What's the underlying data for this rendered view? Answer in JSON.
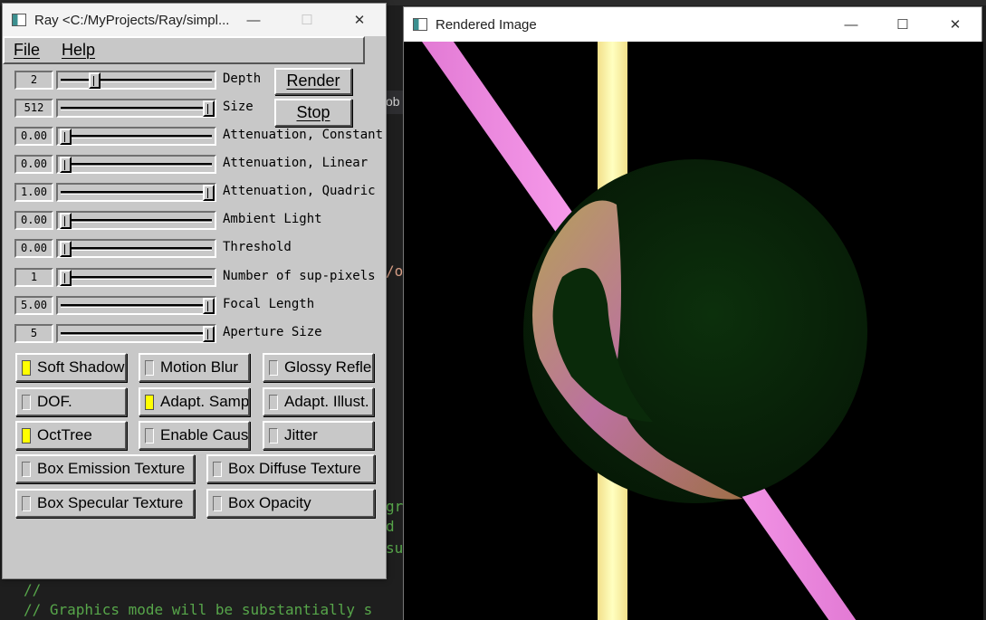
{
  "left_window": {
    "title": "Ray <C:/MyProjects/Ray/simpl...",
    "controls": {
      "minimize": "—",
      "maximize": "☐",
      "close": "✕"
    },
    "menu": [
      "File",
      "Help"
    ],
    "sliders": [
      {
        "value": "2",
        "label": "Depth",
        "position": 0.2
      },
      {
        "value": "512",
        "label": "Size",
        "position": 1.0
      },
      {
        "value": "0.00",
        "label": "Attenuation, Constant",
        "position": 0.0
      },
      {
        "value": "0.00",
        "label": "Attenuation, Linear",
        "position": 0.0
      },
      {
        "value": "1.00",
        "label": "Attenuation, Quadric",
        "position": 1.0
      },
      {
        "value": "0.00",
        "label": "Ambient Light",
        "position": 0.0
      },
      {
        "value": "0.00",
        "label": "Threshold",
        "position": 0.0
      },
      {
        "value": "1",
        "label": "Number of sup-pixels",
        "position": 0.0
      },
      {
        "value": "5.00",
        "label": "Focal Length",
        "position": 1.0
      },
      {
        "value": "5",
        "label": "Aperture Size",
        "position": 1.0
      }
    ],
    "buttons": {
      "render": "Render",
      "stop": "Stop"
    },
    "checkboxes": [
      {
        "label": "Soft Shadow",
        "checked": true
      },
      {
        "label": "Motion Blur",
        "checked": false
      },
      {
        "label": "Glossy Reflect.",
        "checked": false
      },
      {
        "label": "DOF.",
        "checked": false
      },
      {
        "label": "Adapt. Sampl.",
        "checked": true
      },
      {
        "label": "Adapt. Illust.",
        "checked": false
      },
      {
        "label": "OctTree",
        "checked": true
      },
      {
        "label": "Enable Caustic",
        "checked": false
      },
      {
        "label": "Jitter",
        "checked": false
      },
      {
        "label": "Box Emission Texture",
        "checked": false
      },
      {
        "label": "Box Diffuse Texture",
        "checked": false
      },
      {
        "label": "Box Specular Texture",
        "checked": false
      },
      {
        "label": "Box Opacity",
        "checked": false
      }
    ]
  },
  "right_window": {
    "title": "Rendered Image",
    "controls": {
      "minimize": "—",
      "maximize": "☐",
      "close": "✕"
    }
  },
  "background_code": {
    "line1": "//",
    "line2": "// Graphics mode will be substantially s",
    "frag1": "gr",
    "frag2": "d",
    "frag3": "su",
    "frag4": "/o",
    "frag5": "ob"
  },
  "colors": {
    "checked": "#ffff00",
    "dialog_bg": "#c8c8c8",
    "pink_beam": "#ff9cf0",
    "yellow_beam": "#ffffb0",
    "sphere": "#0a2a0a"
  }
}
